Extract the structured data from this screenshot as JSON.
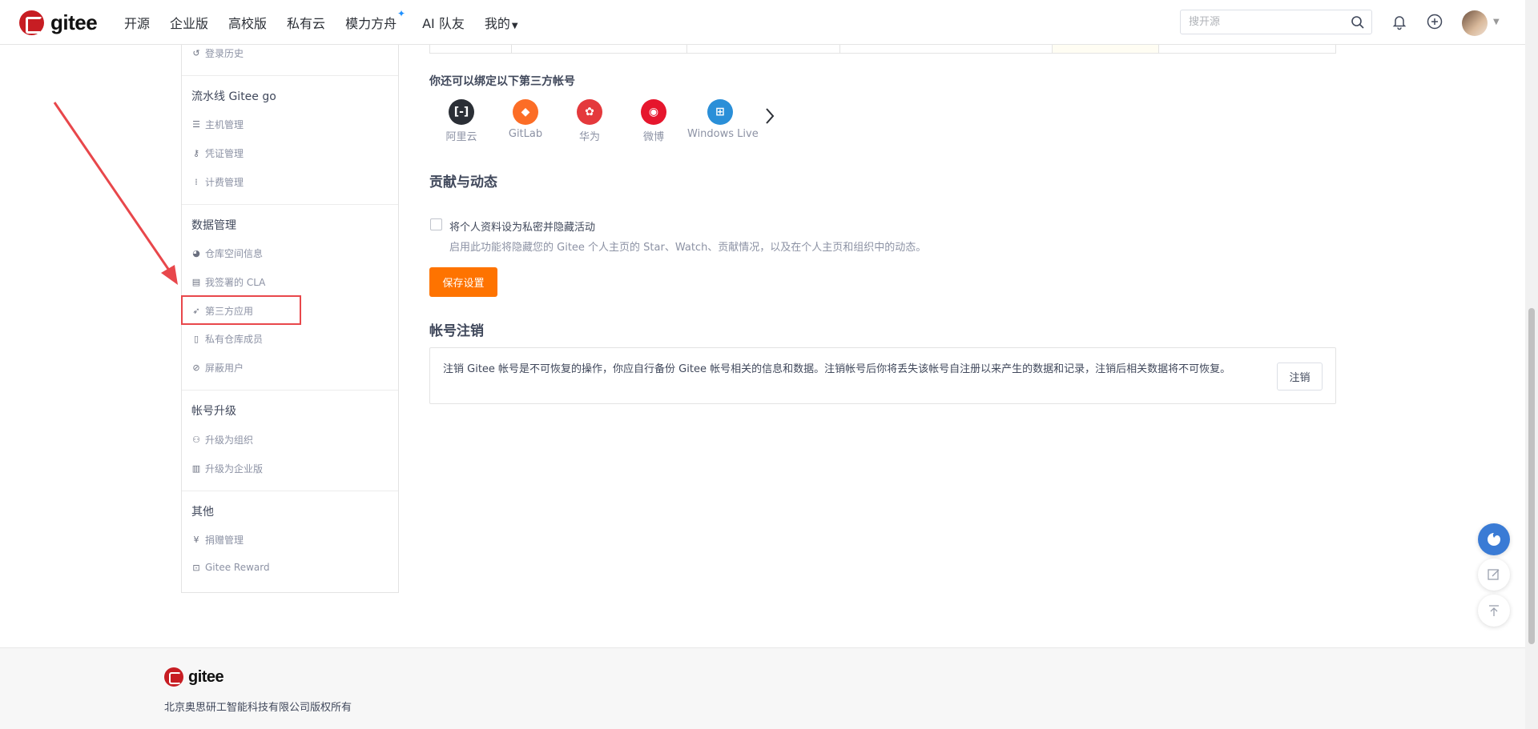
{
  "brand": {
    "name": "gitee",
    "color": "#c71d23"
  },
  "nav": {
    "items": [
      "开源",
      "企业版",
      "高校版",
      "私有云",
      "模力方舟",
      "AI 队友",
      "我的"
    ]
  },
  "search": {
    "placeholder": "搜开源"
  },
  "sidebar": {
    "item_login_history": "登录历史",
    "section_pipeline": "流水线 Gitee go",
    "item_hosts": "主机管理",
    "item_credentials": "凭证管理",
    "item_billing": "计费管理",
    "section_data": "数据管理",
    "item_repo_space": "仓库空间信息",
    "item_cla": "我签署的 CLA",
    "item_third_party": "第三方应用",
    "item_private_members": "私有仓库成员",
    "item_blocked_users": "屏蔽用户",
    "section_upgrade": "帐号升级",
    "item_upgrade_org": "升级为组织",
    "item_upgrade_enterprise": "升级为企业版",
    "section_other": "其他",
    "item_donation": "捐赠管理",
    "item_reward": "Gitee Reward"
  },
  "main": {
    "bind_title": "你还可以绑定以下第三方帐号",
    "third_party": [
      {
        "label": "阿里云",
        "icon": "aliyun-icon",
        "color": "#2b2f36"
      },
      {
        "label": "GitLab",
        "icon": "gitlab-icon",
        "color": "#fc6d26"
      },
      {
        "label": "华为",
        "icon": "huawei-icon",
        "color": "#e4393c"
      },
      {
        "label": "微博",
        "icon": "weibo-icon",
        "color": "#e6162d"
      },
      {
        "label": "Windows Live",
        "icon": "windows-icon",
        "color": "#2a8fd8"
      }
    ],
    "contrib_title": "贡献与动态",
    "private_checkbox_label": "将个人资料设为私密并隐藏活动",
    "private_checkbox_desc": "启用此功能将隐藏您的 Gitee 个人主页的 Star、Watch、贡献情况，以及在个人主页和组织中的动态。",
    "save_button": "保存设置",
    "cancel_title": "帐号注销",
    "cancel_desc": "注销 Gitee 帐号是不可恢复的操作，你应自行备份 Gitee 帐号相关的信息和数据。注销帐号后你将丢失该帐号自注册以来产生的数据和记录，注销后相关数据将不可恢复。",
    "cancel_button": "注销"
  },
  "footer": {
    "brand": "gitee",
    "copyright": "北京奥思研工智能科技有限公司版权所有"
  },
  "colors": {
    "accent": "#fe7300",
    "annotation": "#e8474b"
  }
}
